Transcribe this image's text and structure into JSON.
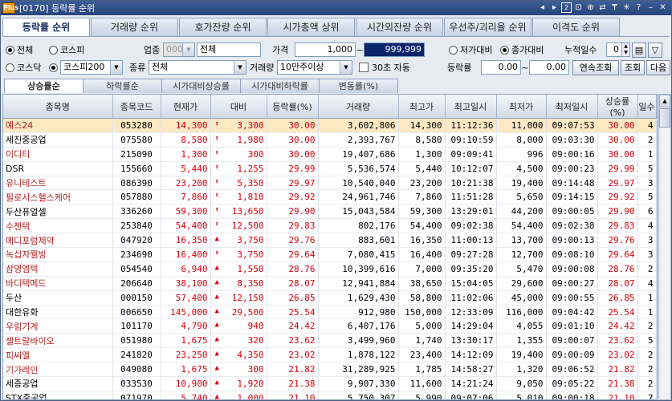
{
  "titlebar": {
    "badge": "Plus",
    "title": "[0170] 등락률 순위",
    "buttons": [
      "◂",
      "▸",
      "2",
      "⊡",
      "⊕",
      "⇄",
      "₸",
      "✳",
      "?",
      "–",
      "✕"
    ]
  },
  "main_tabs": [
    "등락률 순위",
    "거래량 순위",
    "호가잔량 순위",
    "시가총액 상위",
    "시간외잔량 순위",
    "우선주/괴리율 순위",
    "이격도 순위"
  ],
  "filters": {
    "market_all": "전체",
    "kospi": "코스피",
    "kosdaq": "코스닥",
    "market_combo": "코스피200",
    "sector_label": "업종",
    "sector_code": "0000",
    "sector_name": "전체",
    "type_label": "종류",
    "type_value": "전체",
    "price_label": "가격",
    "price_from": "1,000",
    "price_sep": "~",
    "price_to": "999,999",
    "volume_label": "거래량",
    "volume_value": "10만주이상",
    "auto_label": "30초 자동",
    "low_compare": "저가대비",
    "close_compare": "종가대비",
    "days_label": "누적일수",
    "days_value": "0",
    "rate_label": "등락률",
    "rate_from": "0.00",
    "rate_sep": "~",
    "rate_to": "0.00",
    "btn_continuous": "연속조회",
    "btn_query": "조회",
    "btn_next": "다음"
  },
  "sub_tabs": [
    "상승률순",
    "하락률순",
    "시가대비상승률",
    "시가대비하락률",
    "변동률(%)"
  ],
  "columns": [
    "종목명",
    "종목코드",
    "현재가",
    "대비",
    "등락률(%)",
    "거래량",
    "최고가",
    "최고일시",
    "최저가",
    "최저일시",
    "상승률(%)",
    "일수"
  ],
  "rows": [
    {
      "name": "예스24",
      "code": "053280",
      "price": "14,300",
      "arrow": "⬆",
      "diff": "3,300",
      "rate": "30.00",
      "vol": "3,602,806",
      "high": "14,300",
      "htime": "11:12:36",
      "low": "11,000",
      "ltime": "09:07:53",
      "up": "30.00",
      "days": "4",
      "nc": "red"
    },
    {
      "name": "세진중공업",
      "code": "075580",
      "price": "8,580",
      "arrow": "⬆",
      "diff": "1,980",
      "rate": "30.00",
      "vol": "2,393,767",
      "high": "8,580",
      "htime": "09:10:59",
      "low": "8,000",
      "ltime": "09:03:30",
      "up": "30.00",
      "days": "2",
      "nc": "blk"
    },
    {
      "name": "이디티",
      "code": "215090",
      "price": "1,300",
      "arrow": "⬆",
      "diff": "300",
      "rate": "30.00",
      "vol": "19,407,686",
      "high": "1,300",
      "htime": "09:09:41",
      "low": "996",
      "ltime": "09:00:16",
      "up": "30.00",
      "days": "1",
      "nc": "red"
    },
    {
      "name": "DSR",
      "code": "155660",
      "price": "5,440",
      "arrow": "⬆",
      "diff": "1,255",
      "rate": "29.99",
      "vol": "5,536,574",
      "high": "5,440",
      "htime": "10:12:07",
      "low": "4,500",
      "ltime": "09:00:23",
      "up": "29.99",
      "days": "5",
      "nc": "blk"
    },
    {
      "name": "유니테스트",
      "code": "086390",
      "price": "23,200",
      "arrow": "⬆",
      "diff": "5,350",
      "rate": "29.97",
      "vol": "10,540,040",
      "high": "23,200",
      "htime": "10:21:38",
      "low": "19,400",
      "ltime": "09:14:48",
      "up": "29.97",
      "days": "3",
      "nc": "red"
    },
    {
      "name": "필로시스헬스케어",
      "code": "057880",
      "price": "7,860",
      "arrow": "⬆",
      "diff": "1,810",
      "rate": "29.92",
      "vol": "24,961,746",
      "high": "7,860",
      "htime": "11:51:28",
      "low": "5,650",
      "ltime": "09:14:15",
      "up": "29.92",
      "days": "5",
      "nc": "red"
    },
    {
      "name": "두산퓨얼셀",
      "code": "336260",
      "price": "59,300",
      "arrow": "⬆",
      "diff": "13,650",
      "rate": "29.90",
      "vol": "15,043,584",
      "high": "59,300",
      "htime": "13:29:01",
      "low": "44,200",
      "ltime": "09:00:05",
      "up": "29.90",
      "days": "6",
      "nc": "blk"
    },
    {
      "name": "수젠텍",
      "code": "253840",
      "price": "54,400",
      "arrow": "⬆",
      "diff": "12,500",
      "rate": "29.83",
      "vol": "802,176",
      "high": "54,400",
      "htime": "09:02:38",
      "low": "54,400",
      "ltime": "09:02:38",
      "up": "29.83",
      "days": "4",
      "nc": "red"
    },
    {
      "name": "메디포럼제약",
      "code": "047920",
      "price": "16,350",
      "arrow": "▲",
      "diff": "3,750",
      "rate": "29.76",
      "vol": "883,601",
      "high": "16,350",
      "htime": "11:00:13",
      "low": "13,700",
      "ltime": "09:00:13",
      "up": "29.76",
      "days": "3",
      "nc": "red"
    },
    {
      "name": "녹십자웰빙",
      "code": "234690",
      "price": "16,400",
      "arrow": "⬆",
      "diff": "3,750",
      "rate": "29.64",
      "vol": "7,080,415",
      "high": "16,400",
      "htime": "09:27:28",
      "low": "12,700",
      "ltime": "09:08:10",
      "up": "29.64",
      "days": "3",
      "nc": "red"
    },
    {
      "name": "삼영엠텍",
      "code": "054540",
      "price": "6,940",
      "arrow": "▲",
      "diff": "1,550",
      "rate": "28.76",
      "vol": "10,399,616",
      "high": "7,000",
      "htime": "09:35:20",
      "low": "5,470",
      "ltime": "09:00:08",
      "up": "28.76",
      "days": "2",
      "nc": "red"
    },
    {
      "name": "바디텍메드",
      "code": "206640",
      "price": "38,100",
      "arrow": "▲",
      "diff": "8,350",
      "rate": "28.07",
      "vol": "12,941,884",
      "high": "38,650",
      "htime": "15:04:05",
      "low": "29,600",
      "ltime": "09:00:27",
      "up": "28.07",
      "days": "4",
      "nc": "red"
    },
    {
      "name": "두산",
      "code": "000150",
      "price": "57,400",
      "arrow": "▲",
      "diff": "12,150",
      "rate": "26.85",
      "vol": "1,629,430",
      "high": "58,800",
      "htime": "11:02:06",
      "low": "45,000",
      "ltime": "09:00:55",
      "up": "26.85",
      "days": "1",
      "nc": "blk"
    },
    {
      "name": "대한유화",
      "code": "006650",
      "price": "145,000",
      "arrow": "▲",
      "diff": "29,500",
      "rate": "25.54",
      "vol": "912,980",
      "high": "150,000",
      "htime": "12:33:09",
      "low": "116,000",
      "ltime": "09:04:42",
      "up": "25.54",
      "days": "1",
      "nc": "blk"
    },
    {
      "name": "우림기계",
      "code": "101170",
      "price": "4,790",
      "arrow": "▲",
      "diff": "940",
      "rate": "24.42",
      "vol": "6,407,176",
      "high": "5,000",
      "htime": "14:29:04",
      "low": "4,055",
      "ltime": "09:01:10",
      "up": "24.42",
      "days": "2",
      "nc": "red"
    },
    {
      "name": "셀트랄바이오",
      "code": "051980",
      "price": "1,675",
      "arrow": "▲",
      "diff": "320",
      "rate": "23.62",
      "vol": "3,499,960",
      "high": "1,740",
      "htime": "13:30:17",
      "low": "1,355",
      "ltime": "09:00:07",
      "up": "23.62",
      "days": "5",
      "nc": "red"
    },
    {
      "name": "피씨엘",
      "code": "241820",
      "price": "23,250",
      "arrow": "▲",
      "diff": "4,350",
      "rate": "23.02",
      "vol": "1,878,122",
      "high": "23,400",
      "htime": "14:12:09",
      "low": "19,400",
      "ltime": "09:00:09",
      "up": "23.02",
      "days": "2",
      "nc": "red"
    },
    {
      "name": "기가레인",
      "code": "049080",
      "price": "1,675",
      "arrow": "▲",
      "diff": "300",
      "rate": "21.82",
      "vol": "31,289,925",
      "high": "1,785",
      "htime": "14:58:27",
      "low": "1,320",
      "ltime": "09:06:52",
      "up": "21.82",
      "days": "2",
      "nc": "red"
    },
    {
      "name": "세종공업",
      "code": "033530",
      "price": "10,900",
      "arrow": "▲",
      "diff": "1,920",
      "rate": "21.38",
      "vol": "9,907,330",
      "high": "11,600",
      "htime": "14:21:24",
      "low": "9,050",
      "ltime": "09:05:22",
      "up": "21.38",
      "days": "2",
      "nc": "blk"
    },
    {
      "name": "STX중공업",
      "code": "071970",
      "price": "5,740",
      "arrow": "▲",
      "diff": "1,000",
      "rate": "21.10",
      "vol": "5,750,307",
      "high": "5,990",
      "htime": "09:07:06",
      "low": "5,010",
      "ltime": "09:00:18",
      "up": "21.10",
      "days": "7",
      "nc": "blk"
    }
  ]
}
